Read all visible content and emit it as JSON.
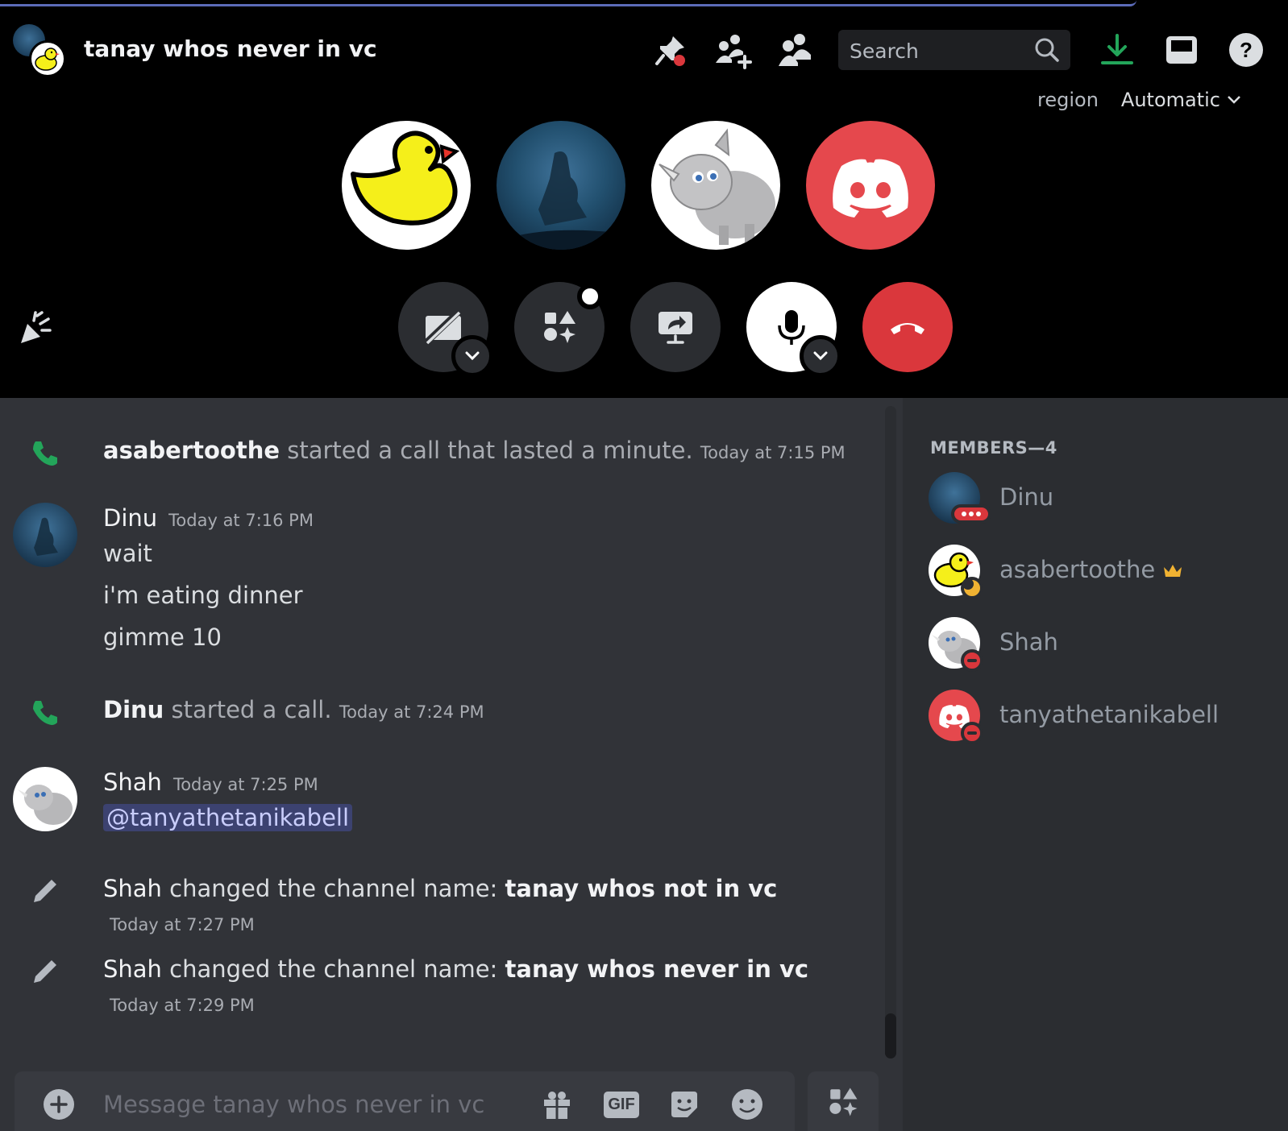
{
  "header": {
    "channel_title": "tanay whos never in vc",
    "search_placeholder": "Search"
  },
  "region": {
    "label": "region",
    "value": "Automatic"
  },
  "participants": [
    "duck-avatar",
    "dinu-avatar",
    "rhino-avatar",
    "discord-default-avatar"
  ],
  "call_controls": [
    "camera-off",
    "activities",
    "screen-share",
    "microphone",
    "disconnect"
  ],
  "colors": {
    "accent": "#5865f2",
    "danger": "#da373c",
    "online_green": "#23a55a",
    "download_green": "#23a55a",
    "mention_bg": "#3c4270",
    "crown": "#f0b232",
    "idle": "#f0b232"
  },
  "messages": {
    "m1": {
      "author": "asabertoothe",
      "text": "started a call that lasted a minute.",
      "time": "Today at 7:15 PM"
    },
    "m2": {
      "author": "Dinu",
      "time": "Today at 7:16 PM",
      "lines": [
        "wait",
        "i'm eating dinner",
        "gimme 10"
      ]
    },
    "m3": {
      "author": "Dinu",
      "text": "started a call.",
      "time": "Today at 7:24 PM"
    },
    "m4": {
      "author": "Shah",
      "time": "Today at 7:25 PM",
      "mention": "@tanyathetanikabell"
    },
    "m5": {
      "author": "Shah",
      "text": "changed the channel name:",
      "new_name": "tanay whos not in vc",
      "time": "Today at 7:27 PM"
    },
    "m6": {
      "author": "Shah",
      "text": "changed the channel name:",
      "new_name": "tanay whos never in vc",
      "time": "Today at 7:29 PM"
    }
  },
  "composer": {
    "placeholder": "Message tanay whos never in vc",
    "gif_label": "GIF"
  },
  "members": {
    "header": "MEMBERS—4",
    "list": [
      {
        "name": "Dinu",
        "status": "in-call"
      },
      {
        "name": "asabertoothe",
        "status": "idle",
        "owner": true
      },
      {
        "name": "Shah",
        "status": "dnd"
      },
      {
        "name": "tanyathetanikabell",
        "status": "dnd"
      }
    ]
  }
}
